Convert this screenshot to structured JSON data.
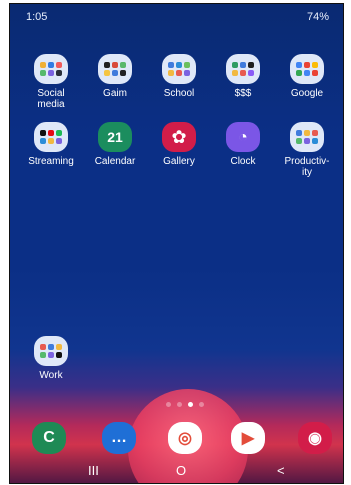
{
  "status": {
    "time": "1:05",
    "right": "74%"
  },
  "home": {
    "rows": [
      [
        {
          "label": "Social\nmedia",
          "type": "folder",
          "colors": [
            "#f0b136",
            "#2f7be3",
            "#f05b5b",
            "#55b96b",
            "#7a62e0",
            "#2a2f3a"
          ]
        },
        {
          "label": "Gaim",
          "type": "folder",
          "colors": [
            "#1f1f1f",
            "#d94a3a",
            "#59b86a",
            "#f5c542",
            "#3f7bdc",
            "#222222"
          ]
        },
        {
          "label": "School",
          "type": "folder",
          "colors": [
            "#3f7bdc",
            "#2b8dd8",
            "#6bc05d",
            "#f1b941",
            "#e75a51",
            "#7a62e0"
          ]
        },
        {
          "label": "$$$",
          "type": "folder",
          "colors": [
            "#2e9b62",
            "#3f7bdc",
            "#1f1f1f",
            "#f1b941",
            "#e75a51",
            "#8b5cf6"
          ]
        },
        {
          "label": "Google",
          "type": "folder",
          "colors": [
            "#4285F4",
            "#EA4335",
            "#FBBC05",
            "#34A853",
            "#4285F4",
            "#EA4335"
          ]
        }
      ],
      [
        {
          "label": "Streaming",
          "type": "folder",
          "colors": [
            "#111111",
            "#e50914",
            "#1db954",
            "#2b8dd8",
            "#f1b941",
            "#7a62e0"
          ]
        },
        {
          "label": "Calendar",
          "type": "app",
          "text": "21",
          "cls": "cal"
        },
        {
          "label": "Gallery",
          "type": "app",
          "text": "✿",
          "cls": "gal"
        },
        {
          "label": "Clock",
          "type": "app",
          "text": "◔",
          "cls": "clk"
        },
        {
          "label": "Productiv-\nity",
          "type": "folder",
          "colors": [
            "#3f7bdc",
            "#f1b941",
            "#e75a51",
            "#55b96b",
            "#7a62e0",
            "#2b8dd8"
          ]
        }
      ]
    ],
    "work": {
      "label": "Work",
      "type": "folder",
      "colors": [
        "#e75a51",
        "#3f7bdc",
        "#f1b941",
        "#55b96b",
        "#7a62e0",
        "#111111"
      ]
    }
  },
  "dock": [
    {
      "name": "phone",
      "glyph": "C",
      "bg": "#1e8a55"
    },
    {
      "name": "messages",
      "glyph": "…",
      "bg": "#1f6fd6"
    },
    {
      "name": "chrome",
      "glyph": "◎",
      "bg": "#ffffff"
    },
    {
      "name": "play-store",
      "glyph": "▶",
      "bg": "#ffffff"
    },
    {
      "name": "camera",
      "glyph": "◉",
      "bg": "#d21d49"
    }
  ],
  "nav": {
    "recent": "III",
    "home": "O",
    "back": "<"
  }
}
